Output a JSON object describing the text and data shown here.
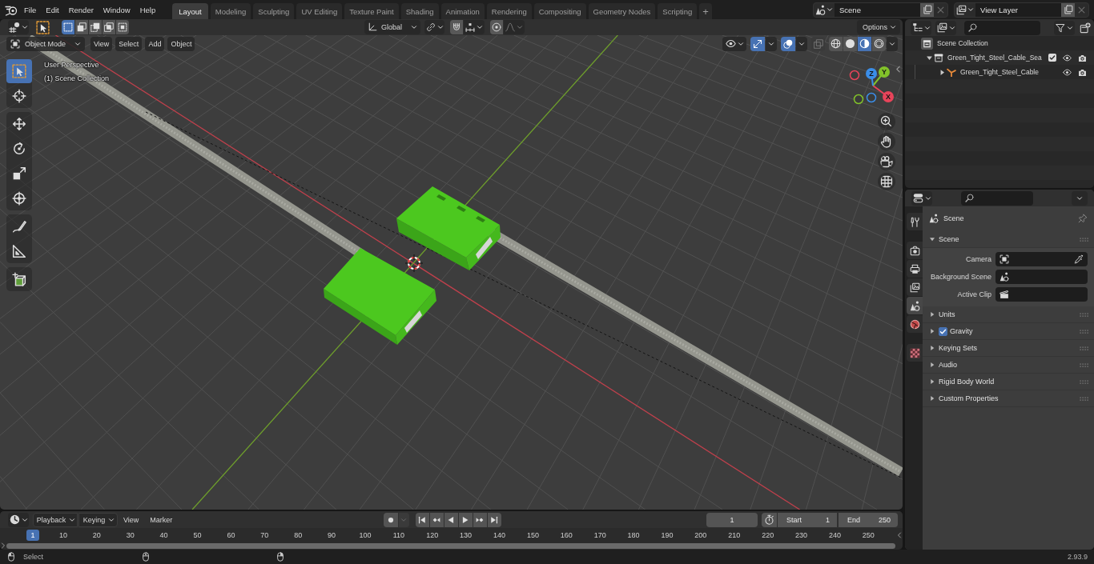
{
  "top_bar": {
    "menus": [
      "File",
      "Edit",
      "Render",
      "Window",
      "Help"
    ],
    "workspaces": [
      {
        "label": "Layout",
        "selected": true
      },
      {
        "label": "Modeling",
        "selected": false
      },
      {
        "label": "Sculpting",
        "selected": false
      },
      {
        "label": "UV Editing",
        "selected": false
      },
      {
        "label": "Texture Paint",
        "selected": false
      },
      {
        "label": "Shading",
        "selected": false
      },
      {
        "label": "Animation",
        "selected": false
      },
      {
        "label": "Rendering",
        "selected": false
      },
      {
        "label": "Compositing",
        "selected": false
      },
      {
        "label": "Geometry Nodes",
        "selected": false
      },
      {
        "label": "Scripting",
        "selected": false
      }
    ],
    "add_workspace": "+",
    "scene": "Scene",
    "view_layer": "View Layer"
  },
  "viewport": {
    "tool_header": {
      "select_modes": [
        {
          "kind": "set",
          "selected": true
        },
        {
          "kind": "extend",
          "selected": false
        },
        {
          "kind": "subtract",
          "selected": false
        },
        {
          "kind": "invert",
          "selected": false
        },
        {
          "kind": "intersect",
          "selected": false
        }
      ],
      "orientation": "Global",
      "snap": false,
      "proportional_editing": false,
      "options": "Options"
    },
    "header": {
      "mode": "Object Mode",
      "menus": [
        "View",
        "Select",
        "Add",
        "Object"
      ],
      "gizmos": true,
      "overlays": true,
      "xray": false,
      "shading": [
        {
          "kind": "wireframe",
          "selected": false
        },
        {
          "kind": "solid",
          "selected": false
        },
        {
          "kind": "material",
          "selected": true
        },
        {
          "kind": "rendered",
          "selected": false
        }
      ]
    },
    "info": [
      "User Perspective",
      "(1) Scene Collection"
    ],
    "toolbar": [
      [
        {
          "kind": "select",
          "selected": true
        },
        {
          "kind": "cursor",
          "selected": false
        }
      ],
      [
        {
          "kind": "move",
          "selected": false
        },
        {
          "kind": "rotate",
          "selected": false
        },
        {
          "kind": "scale",
          "selected": false
        },
        {
          "kind": "transform",
          "selected": false
        }
      ],
      [
        {
          "kind": "annotate",
          "selected": false
        },
        {
          "kind": "measure",
          "selected": false
        }
      ],
      [
        {
          "kind": "add",
          "selected": false
        }
      ]
    ],
    "gizmo_axes": [
      {
        "kind": "x",
        "label": "X"
      },
      {
        "kind": "y",
        "label": "Y"
      },
      {
        "kind": "z",
        "label": "Z"
      }
    ]
  },
  "outliner": {
    "tree": [
      {
        "label": "Scene Collection",
        "kind": "root",
        "children": [
          {
            "label": "Green_Tight_Steel_Cable_Sea",
            "kind": "collection",
            "expanded": true,
            "checked": true,
            "children": [
              {
                "label": "Green_Tight_Steel_Cable",
                "kind": "empty",
                "expanded": false
              }
            ]
          }
        ]
      }
    ]
  },
  "properties": {
    "tab_groups": [
      [
        {
          "kind": "tool",
          "selected": false
        }
      ],
      [
        {
          "kind": "render",
          "selected": false
        },
        {
          "kind": "output",
          "selected": false
        },
        {
          "kind": "view_layer",
          "selected": false
        },
        {
          "kind": "scene",
          "selected": true
        },
        {
          "kind": "world",
          "selected": false
        }
      ],
      [
        {
          "kind": "texture",
          "selected": false
        }
      ]
    ],
    "context": "Scene",
    "panels": [
      {
        "label": "Scene",
        "expanded": true,
        "fields": [
          {
            "label": "Camera",
            "kind": "camera"
          },
          {
            "label": "Background Scene",
            "kind": "scene"
          },
          {
            "label": "Active Clip",
            "kind": "clip"
          }
        ]
      },
      {
        "label": "Units",
        "expanded": false
      },
      {
        "label": "Gravity",
        "expanded": false,
        "checked": true
      },
      {
        "label": "Keying Sets",
        "expanded": false
      },
      {
        "label": "Audio",
        "expanded": false
      },
      {
        "label": "Rigid Body World",
        "expanded": false
      },
      {
        "label": "Custom Properties",
        "expanded": false
      }
    ]
  },
  "timeline": {
    "menus": [
      {
        "label": "Playback",
        "kind": "dropdown"
      },
      {
        "label": "Keying",
        "kind": "dropdown"
      },
      {
        "label": "View",
        "kind": "menu"
      },
      {
        "label": "Marker",
        "kind": "menu"
      }
    ],
    "auto_keying": false,
    "current_frame": "1",
    "start": {
      "label": "Start",
      "value": "1"
    },
    "end": {
      "label": "End",
      "value": "250"
    },
    "playhead": "1",
    "ruler": [
      "10",
      "20",
      "30",
      "40",
      "50",
      "60",
      "70",
      "80",
      "90",
      "100",
      "110",
      "120",
      "130",
      "140",
      "150",
      "160",
      "170",
      "180",
      "190",
      "200",
      "210",
      "220",
      "230",
      "240",
      "250"
    ]
  },
  "status_bar": {
    "hints": [
      {
        "kind": "left",
        "label": "Select"
      },
      {
        "kind": "middle"
      },
      {
        "kind": "right"
      }
    ],
    "version": "2.93.9"
  }
}
